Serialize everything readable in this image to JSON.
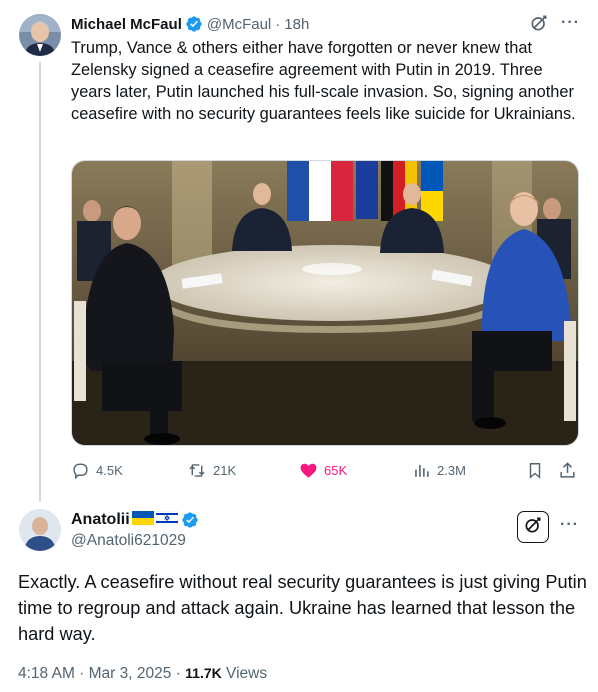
{
  "tweet": {
    "author_name": "Michael McFaul",
    "author_handle": "@McFaul",
    "separator": "·",
    "time_ago": "18h",
    "more_label": "···",
    "text": "Trump, Vance & others either have forgotten or never knew that Zelensky signed a ceasefire agreement with Putin in 2019.  Three years later, Putin launched his full-scale invasion. So,  signing another ceasefire with no security guarantees feels like suicide for Ukrainians.",
    "actions": {
      "replies": "4.5K",
      "reposts": "21K",
      "likes": "65K",
      "views": "2.3M"
    }
  },
  "reply": {
    "author_name": "Anatolii",
    "author_handle": "@Anatoli621029",
    "more_label": "···",
    "text": "Exactly. A ceasefire without real security guarantees is just giving Putin time to regroup and attack again. Ukraine has learned that lesson the hard way.",
    "meta_time": "4:18 AM · Mar 3, 2025 · ",
    "meta_views_count": "11.7K",
    "meta_views_label": " Views"
  },
  "colors": {
    "verified": "#1d9bf0",
    "like": "#f91880",
    "muted": "#536471",
    "text": "#0f1419",
    "border": "#cfd9de"
  },
  "icons": [
    "verified-badge-icon",
    "grok-icon",
    "more-icon",
    "reply-icon",
    "repost-icon",
    "like-icon",
    "views-icon",
    "bookmark-icon",
    "share-icon"
  ]
}
